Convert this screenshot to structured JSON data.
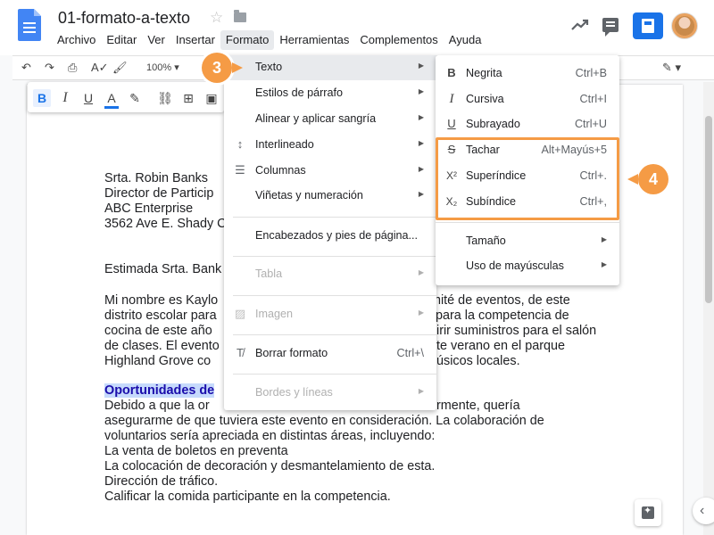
{
  "header": {
    "doc_title": "01-formato-a-texto",
    "menus": [
      "Archivo",
      "Editar",
      "Ver",
      "Insertar",
      "Formato",
      "Herramientas",
      "Complementos",
      "Ayuda"
    ],
    "active_menu": "Formato"
  },
  "toolbar": {
    "zoom": "100%"
  },
  "format_bar": {
    "bold": "B",
    "italic": "I",
    "underline": "U",
    "text_color": "A"
  },
  "document": {
    "address": [
      "Srta. Robin Banks",
      "Director de Particip",
      "ABC Enterprise",
      "3562 Ave E. Shady C"
    ],
    "greeting": "Estimada Srta. Bank",
    "para1": [
      "Mi nombre es Kaylo",
      "distrito escolar para",
      "cocina de este año",
      "de clases. El evento",
      "Highland Grove co"
    ],
    "para1_right": [
      "mité de eventos, de este",
      "para la competencia de",
      "irir suministros para el salón",
      "te verano en el parque",
      "úsicos locales."
    ],
    "heading": "Oportunidades de",
    "para2_first": "Debido a que la or",
    "para2_first_right": "rmente, quería",
    "para2": [
      "asegurarme de que tuviera este evento en consideración. La colaboración de",
      "voluntarios sería apreciada en distintas áreas, incluyendo:",
      "La venta de boletos en preventa",
      "La colocación de decoración y desmantelamiento de esta.",
      "Dirección de tráfico.",
      "Calificar la comida participante en la competencia."
    ]
  },
  "format_menu": {
    "items": [
      {
        "label": "Texto",
        "submenu": true
      },
      {
        "label": "Estilos de párrafo",
        "submenu": true
      },
      {
        "label": "Alinear y aplicar sangría",
        "submenu": true
      },
      {
        "label": "Interlineado",
        "submenu": true
      },
      {
        "label": "Columnas",
        "submenu": true
      },
      {
        "label": "Viñetas y numeración",
        "submenu": true
      },
      {
        "label": "Encabezados y pies de página..."
      },
      {
        "label": "Tabla",
        "submenu": true,
        "disabled": true
      },
      {
        "label": "Imagen",
        "submenu": true,
        "disabled": true
      },
      {
        "label": "Borrar formato",
        "shortcut": "Ctrl+\\"
      },
      {
        "label": "Bordes y líneas",
        "submenu": true,
        "disabled": true
      }
    ]
  },
  "text_submenu": {
    "items": [
      {
        "label": "Negrita",
        "shortcut": "Ctrl+B",
        "icon": "B"
      },
      {
        "label": "Cursiva",
        "shortcut": "Ctrl+I",
        "icon": "I"
      },
      {
        "label": "Subrayado",
        "shortcut": "Ctrl+U",
        "icon": "U"
      },
      {
        "label": "Tachar",
        "shortcut": "Alt+Mayús+5",
        "icon": "S"
      },
      {
        "label": "Superíndice",
        "shortcut": "Ctrl+.",
        "icon": "X²"
      },
      {
        "label": "Subíndice",
        "shortcut": "Ctrl+,",
        "icon": "X₂"
      },
      {
        "label": "Tamaño",
        "submenu": true
      },
      {
        "label": "Uso de mayúsculas",
        "submenu": true
      }
    ]
  },
  "callouts": {
    "step3": "3",
    "step4": "4"
  },
  "colors": {
    "accent": "#1a73e8",
    "callout": "#f59b45",
    "highlight": "#c6dafc"
  }
}
